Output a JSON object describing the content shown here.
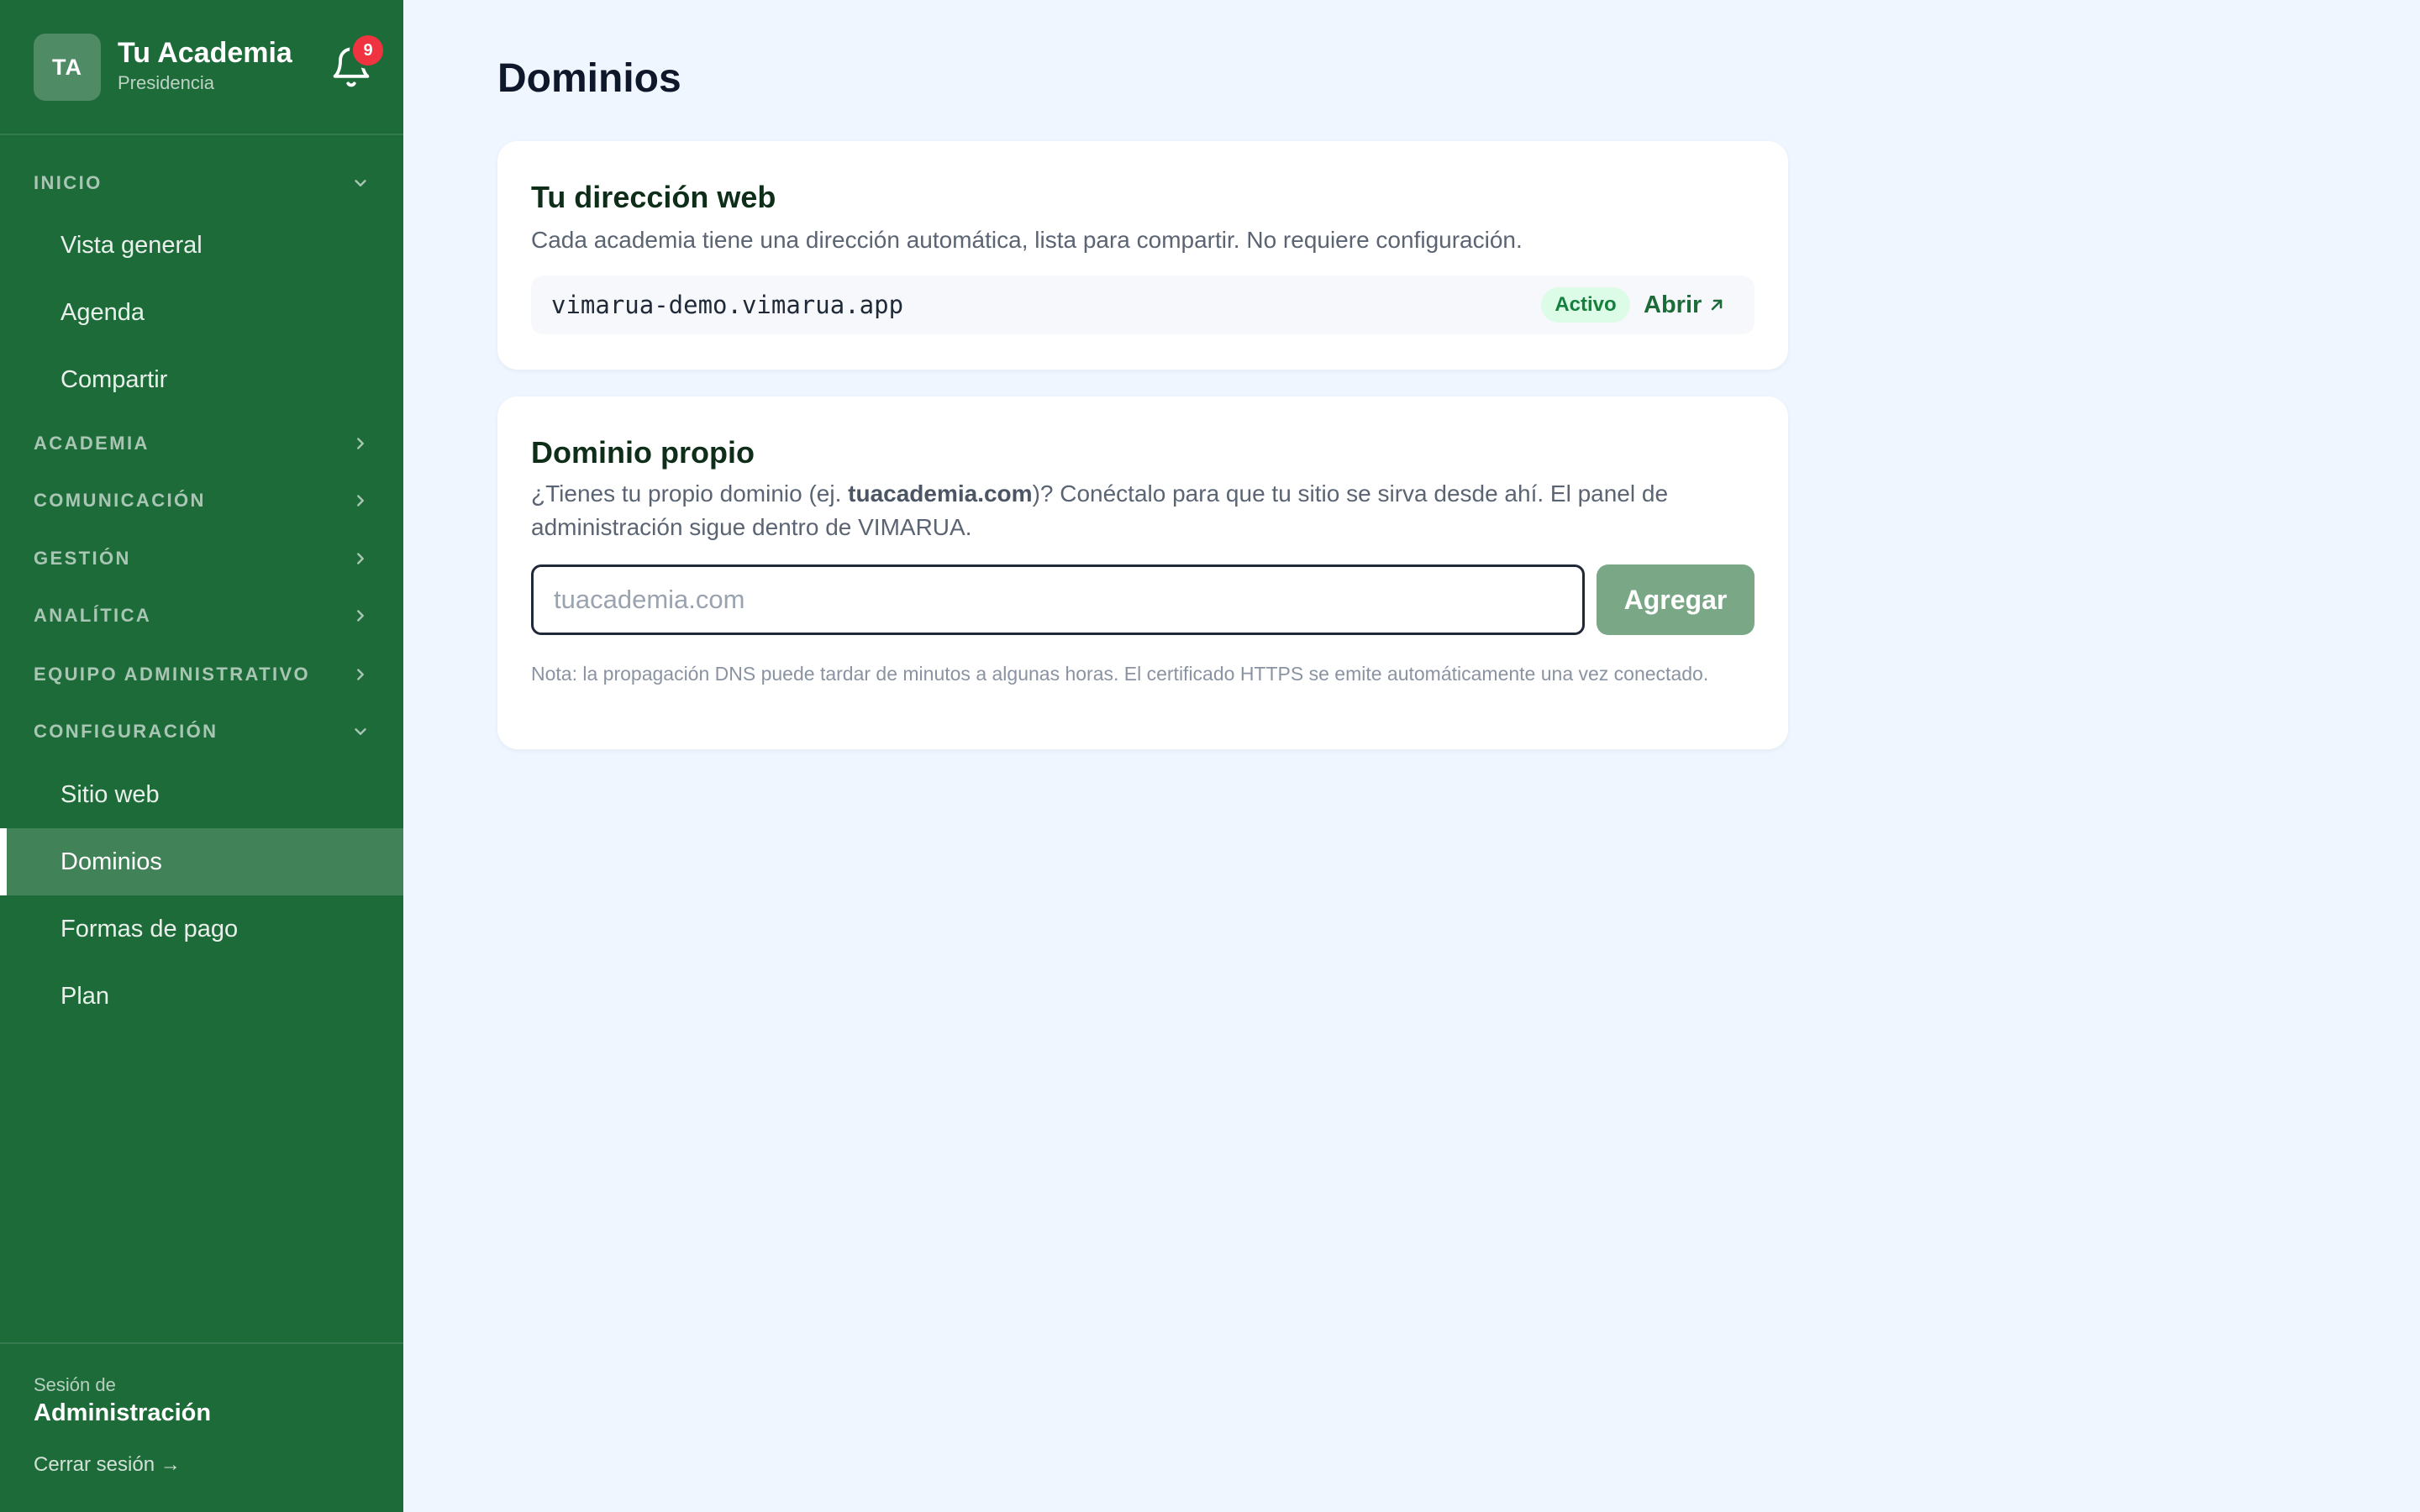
{
  "sidebar": {
    "avatar": "TA",
    "brand_name": "Tu Academia",
    "brand_sub": "Presidencia",
    "notifications_count": "9",
    "sections": {
      "inicio": "INICIO",
      "academia": "ACADEMIA",
      "comunicacion": "COMUNICACIÓN",
      "gestion": "GESTIÓN",
      "analitica": "ANALÍTICA",
      "equipo": "EQUIPO ADMINISTRATIVO",
      "configuracion": "CONFIGURACIÓN"
    },
    "items": {
      "vista_general": "Vista general",
      "agenda": "Agenda",
      "compartir": "Compartir",
      "sitio_web": "Sitio web",
      "dominios": "Dominios",
      "formas_pago": "Formas de pago",
      "plan": "Plan"
    },
    "active_item": "Dominios",
    "footer": {
      "label": "Sesión de",
      "role": "Administración",
      "logout": "Cerrar sesión →"
    }
  },
  "main": {
    "title": "Dominios",
    "web_address": {
      "title": "Tu dirección web",
      "description": "Cada academia tiene una dirección automática, lista para compartir. No requiere configuración.",
      "url": "vimarua-demo.vimarua.app",
      "status": "Activo",
      "open_label": "Abrir"
    },
    "custom_domain": {
      "title": "Dominio propio",
      "desc_before": "¿Tienes tu propio dominio (ej. ",
      "desc_example": "tuacademia.com",
      "desc_after": ")? Conéctalo para que tu sitio se sirva desde ahí. El panel de administración sigue dentro de VIMARUA.",
      "input_value": "",
      "input_placeholder": "tuacademia.com",
      "add_label": "Agregar",
      "note": "Nota: la propagación DNS puede tardar de minutos a algunas horas. El certificado HTTPS se emite automáticamente una vez conectado."
    }
  },
  "colors": {
    "sidebar_bg": "#1e6b3a",
    "page_bg": "#eff6ff",
    "badge": "#ef3340",
    "status_bg": "#dcfce7",
    "status_text": "#15803d",
    "add_button": "#7aa785"
  },
  "icons": {
    "notifications": "bell-icon",
    "expanded": "chevron-down-icon",
    "collapsed": "chevron-right-icon",
    "open_link": "arrow-up-right-icon"
  }
}
